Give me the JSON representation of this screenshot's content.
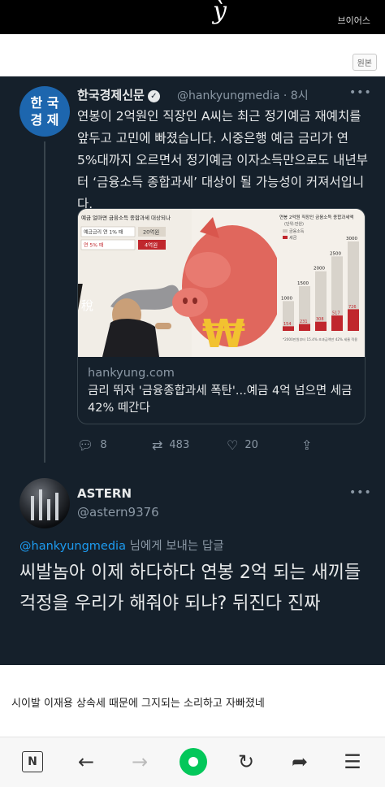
{
  "top_scribble": "ỳ",
  "watermark": "브이어스",
  "orig_button": "원본",
  "tweet": {
    "logo_line1": "한 국",
    "logo_line2": "경 제",
    "name": "한국경제신문",
    "handle": "@hankyungmedia · 8시",
    "text": "연봉이 2억원인 직장인 A씨는 최근 정기예금 재예치를 앞두고 고민에 빠졌습니다. 시중은행 예금 금리가 연 5%대까지 오르면서 정기예금 이자소득만으로도 내년부터 ‘금융소득 종합과세’ 대상이 될 가능성이 커져서입니다.",
    "card": {
      "domain": "hankyung.com",
      "title": "금리 뛰자 '금융종합과세 폭탄'...예금 4억 넘으면 세금 42% 떼간다",
      "graphic": {
        "left_title": "예금 얼마면 금융소득 종합과세 대상되나",
        "row1_label": "예금금리 연 1% 때",
        "row1_value": "20억원",
        "row2_label": "연 5% 때",
        "row2_value": "4억원",
        "tax_char": "稅",
        "won_char": "₩",
        "chart_title": "연봉 2억원 직장인 금융소득 종합과세액",
        "unit": "(단위:만원)",
        "legend_income": "금융소득",
        "legend_tax": "세금",
        "footnote": "*2000만원부터 15.4% 초과금액만 42% 세율 적용"
      }
    },
    "actions": {
      "reply": "8",
      "retweet": "483",
      "like": "20"
    }
  },
  "chart_data": {
    "type": "bar",
    "title": "연봉 2억원 직장인 금융소득 종합과세액",
    "series": [
      {
        "name": "금융소득",
        "values": [
          1000,
          1500,
          2000,
          2500,
          3000
        ]
      },
      {
        "name": "세금",
        "values": [
          154,
          231,
          308,
          517,
          726
        ]
      }
    ],
    "ylim": [
      0,
      3000
    ]
  },
  "reply": {
    "name": "ASTERN",
    "handle": "@astern9376",
    "replying_mention": "@hankyungmedia",
    "replying_suffix": " 님에게 보내는 답글",
    "text": "씨발놈아 이제 하다하다 연봉 2억 되는 새끼들 걱정을 우리가 해줘야 되냐? 뒤진다 진짜"
  },
  "comment": "시이발 이재용 상속세 때문에 그지되는 소리하고 자빠졌네",
  "colors": {
    "tweet_bg": "#15202b",
    "link": "#1d9bf0",
    "brand_green": "#03c75a",
    "logo_blue": "#1d66ae"
  }
}
